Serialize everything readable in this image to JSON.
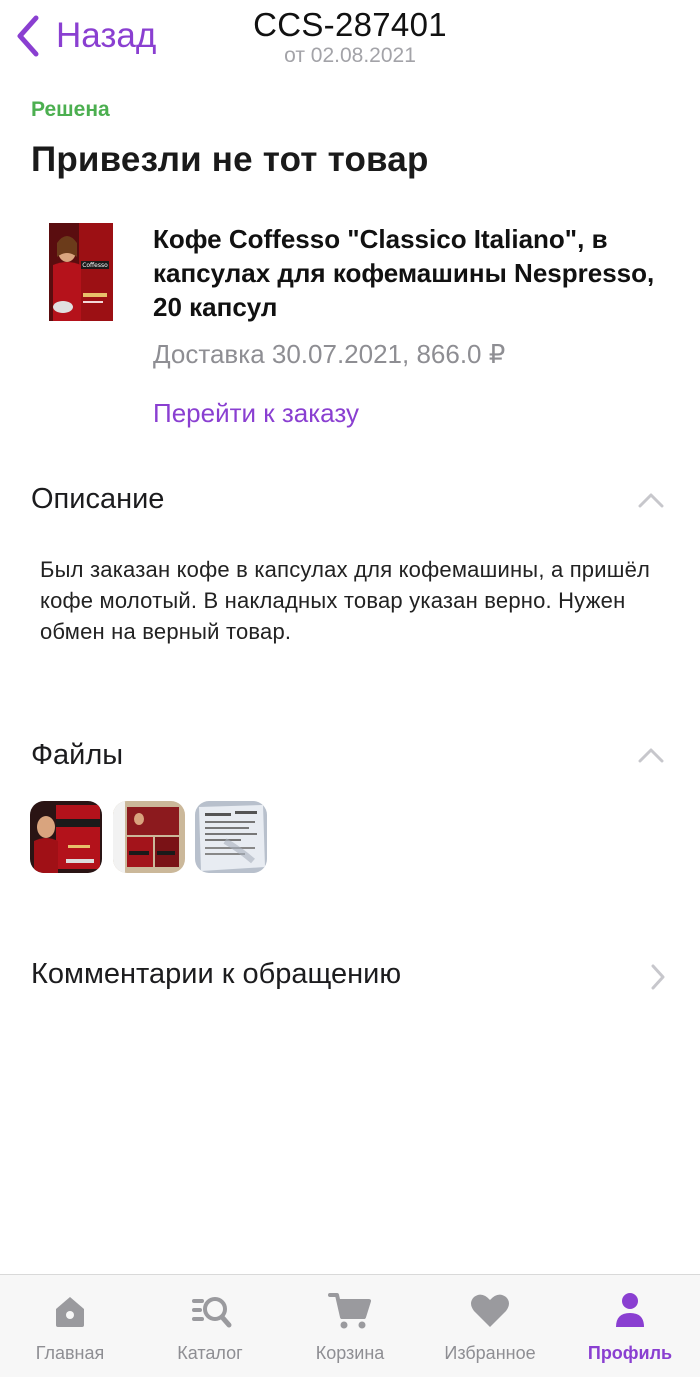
{
  "nav": {
    "back_label": "Назад",
    "title": "CCS-287401",
    "subtitle": "от 02.08.2021"
  },
  "status": "Решена",
  "page_title": "Привезли не тот товар",
  "product": {
    "name": "Кофе Coffesso \"Classico Italiano\", в капсулах для кофемашины Nespresso, 20 капсул",
    "meta": "Доставка 30.07.2021, 866.0 ₽",
    "order_link": "Перейти к заказу",
    "brand_text": "Coffesso"
  },
  "description": {
    "title": "Описание",
    "text": "Был заказан кофе в капсулах для кофемашины, а пришёл кофе молотый. В накладных товар указан верно. Нужен обмен на верный товар."
  },
  "files": {
    "title": "Файлы"
  },
  "comments": {
    "title": "Комментарии к обращению"
  },
  "tabbar": {
    "tabs": [
      {
        "label": "Главная",
        "icon": "home-icon"
      },
      {
        "label": "Каталог",
        "icon": "catalog-search-icon"
      },
      {
        "label": "Корзина",
        "icon": "cart-icon"
      },
      {
        "label": "Избранное",
        "icon": "heart-icon"
      },
      {
        "label": "Профиль",
        "icon": "profile-icon"
      }
    ],
    "active_index": 4
  },
  "colors": {
    "accent": "#8a3fd1",
    "status_green": "#4caf50",
    "secondary_text": "#8e8e93",
    "inactive_icon": "#9a9a9e"
  }
}
